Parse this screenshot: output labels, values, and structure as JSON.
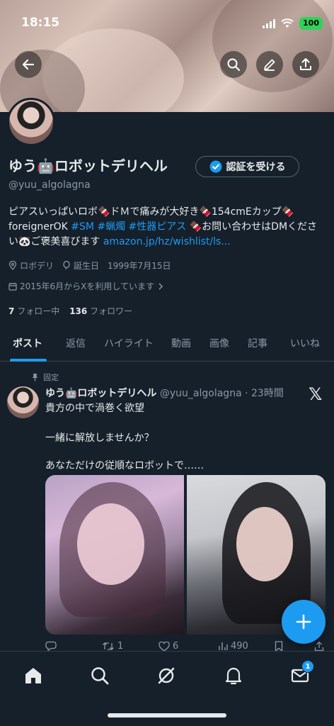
{
  "status_bar": {
    "time": "18:15",
    "battery": "100"
  },
  "profile": {
    "name": "ゆう🤖ロボットデリヘル",
    "handle": "@yuu_algolagna",
    "verify_button": "認証を受ける",
    "bio": {
      "line1": "ピアスいっぱいロボ🍫ドＭで痛みが大好き🍫154cmEカップ🍫",
      "line2_text": "foreignerOK ",
      "line2_tags": "#SM #蝋燭 #性器ピアス",
      "line2_tail": " 🍫お問い合わせはDMくださ",
      "line3_text": "い🐼ご褒美喜びます ",
      "line3_link": "amazon.jp/hz/wishlist/ls..."
    },
    "location": "ロボデリ",
    "birthday": "誕生日　1999年7月15日",
    "joined": "2015年6月からXを利用しています",
    "following_count": "7",
    "following_label": "フォロー中",
    "followers_count": "136",
    "followers_label": "フォロワー"
  },
  "tabs": [
    "ポスト",
    "返信",
    "ハイライト",
    "動画",
    "画像",
    "記事",
    "いいね"
  ],
  "post": {
    "pinned_label": "固定",
    "author_name": "ゆう🤖ロボットデリヘル",
    "author_meta": "@yuu_algolagna · 23時間",
    "lines": [
      "貴方の中で渦巻く欲望",
      "一緒に解放しませんか？",
      "あなただけの従順なロボットで……"
    ],
    "retweets": "1",
    "likes": "6",
    "views": "490"
  },
  "nav": {
    "messages_badge": "1"
  },
  "colors": {
    "accent": "#1d9bf0",
    "background": "#15202b",
    "secondary_text": "#8b98a5"
  }
}
